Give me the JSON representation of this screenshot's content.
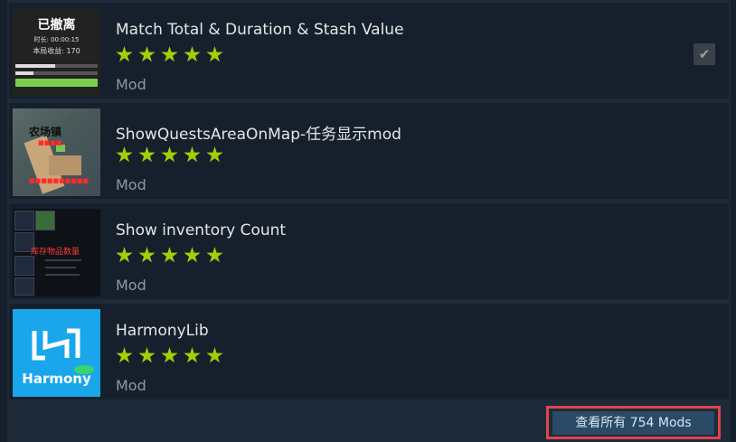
{
  "mods": [
    {
      "title": "Match Total & Duration & Stash Value",
      "rating_stars": 5,
      "type": "Mod",
      "selected": true,
      "thumb_text": {
        "headline": "已撤离",
        "line1": "时长: 00:00:15",
        "line2": "本局收益: 170"
      }
    },
    {
      "title": "ShowQuestsAreaOnMap-任务显示mod",
      "rating_stars": 5,
      "type": "Mod",
      "selected": false,
      "thumb_text": {
        "headline": "农场镇"
      }
    },
    {
      "title": "Show inventory Count",
      "rating_stars": 5,
      "type": "Mod",
      "selected": false,
      "thumb_text": {
        "headline": "库存物品数量"
      }
    },
    {
      "title": "HarmonyLib",
      "rating_stars": 5,
      "type": "Mod",
      "selected": false,
      "thumb_text": {
        "headline": "Harmony"
      }
    }
  ],
  "view_all_label": "查看所有 754 Mods",
  "colors": {
    "background": "#1b2838",
    "row": "#16202d",
    "star": "#a3cf06",
    "highlight_border": "#e0444b",
    "button": "#2a4a66"
  }
}
